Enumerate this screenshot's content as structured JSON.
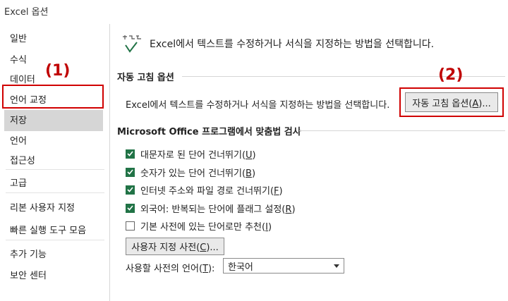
{
  "window": {
    "title": "Excel 옵션"
  },
  "sidebar": {
    "items": [
      {
        "label": "일반"
      },
      {
        "label": "수식"
      },
      {
        "label": "데이터"
      },
      {
        "label": "언어 교정"
      },
      {
        "label": "저장"
      },
      {
        "label": "언어"
      },
      {
        "label": "접근성"
      },
      {
        "label": "고급"
      },
      {
        "label": "리본 사용자 지정"
      },
      {
        "label": "빠른 실행 도구 모음"
      },
      {
        "label": "추가 기능"
      },
      {
        "label": "보안 센터"
      }
    ],
    "selected": "언어 교정"
  },
  "annotations": {
    "callout1": "(1)",
    "callout2": "(2)"
  },
  "header": {
    "text": "Excel에서 텍스트를 수정하거나 서식을 지정하는 방법을 선택합니다."
  },
  "autocorrect": {
    "title": "자동 고침 옵션",
    "description": "Excel에서 텍스트를 수정하거나 서식을 지정하는 방법을 선택합니다.",
    "button_text": "자동 고침 옵션(",
    "button_key": "A",
    "button_tail": ")..."
  },
  "spelling": {
    "title": "Microsoft Office 프로그램에서 맞춤법 검사",
    "options": [
      {
        "text": "대문자로 된 단어 건너뛰기(",
        "key": "U",
        "tail": ")",
        "checked": true
      },
      {
        "text": "숫자가 있는 단어 건너뛰기(",
        "key": "B",
        "tail": ")",
        "checked": true
      },
      {
        "text": "인터넷 주소와 파일 경로 건너뛰기(",
        "key": "F",
        "tail": ")",
        "checked": true
      },
      {
        "text": "외국어: 반복되는 단어에 플래그 설정(",
        "key": "R",
        "tail": ")",
        "checked": true
      },
      {
        "text": "기본 사전에 있는 단어로만 추천(",
        "key": "I",
        "tail": ")",
        "checked": false
      }
    ],
    "custom_dict_text": "사용자 지정 사전(",
    "custom_dict_key": "C",
    "custom_dict_tail": ")...",
    "lang_label_text": "사용할 사전의 언어(",
    "lang_label_key": "T",
    "lang_label_tail": "):",
    "lang_value": "한국어"
  },
  "colors": {
    "accent": "#217346",
    "annotation": "#c00000",
    "selected_bg": "#d6d6d6"
  }
}
